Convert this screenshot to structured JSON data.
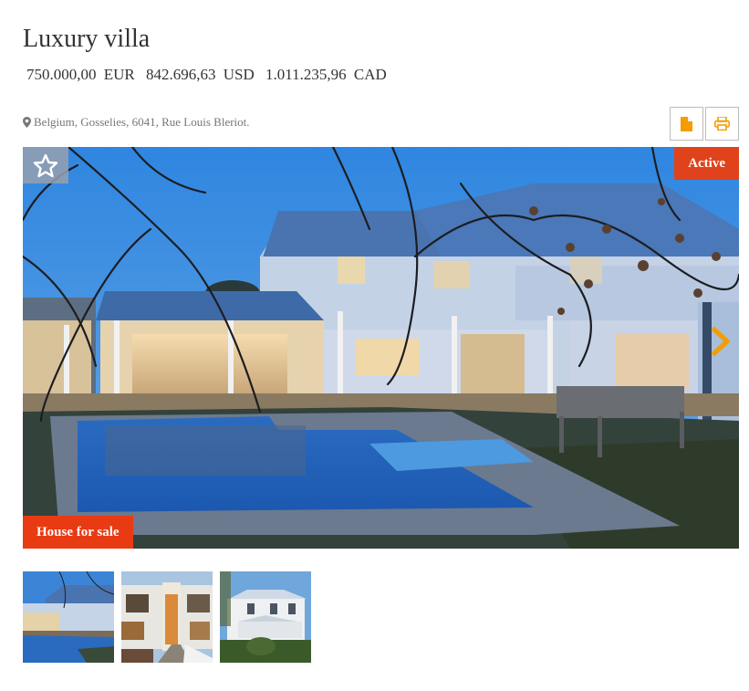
{
  "listing": {
    "title": "Luxury villa",
    "prices": [
      {
        "amount": "750.000,00",
        "currency": "EUR"
      },
      {
        "amount": "842.696,63",
        "currency": "USD"
      },
      {
        "amount": "1.011.235,96",
        "currency": "CAD"
      }
    ],
    "address": "Belgium, Gosselies, 6041, Rue Louis Bleriot.",
    "address_icon": "map-marker-icon"
  },
  "actions": {
    "document_icon": "file-icon",
    "print_icon": "print-icon"
  },
  "gallery": {
    "favorite_icon": "star-outline-icon",
    "status_label": "Active",
    "type_label": "House for sale",
    "next_icon": "chevron-right-icon",
    "thumbnails": [
      {
        "alt": "Villa with pool at dusk"
      },
      {
        "alt": "Modern white house facade"
      },
      {
        "alt": "Victorian white house with veranda"
      }
    ]
  },
  "colors": {
    "accent": "#f59c00",
    "status_badge": "#e0431b",
    "type_badge": "#e83a13",
    "text": "#333333",
    "muted": "#777777"
  }
}
